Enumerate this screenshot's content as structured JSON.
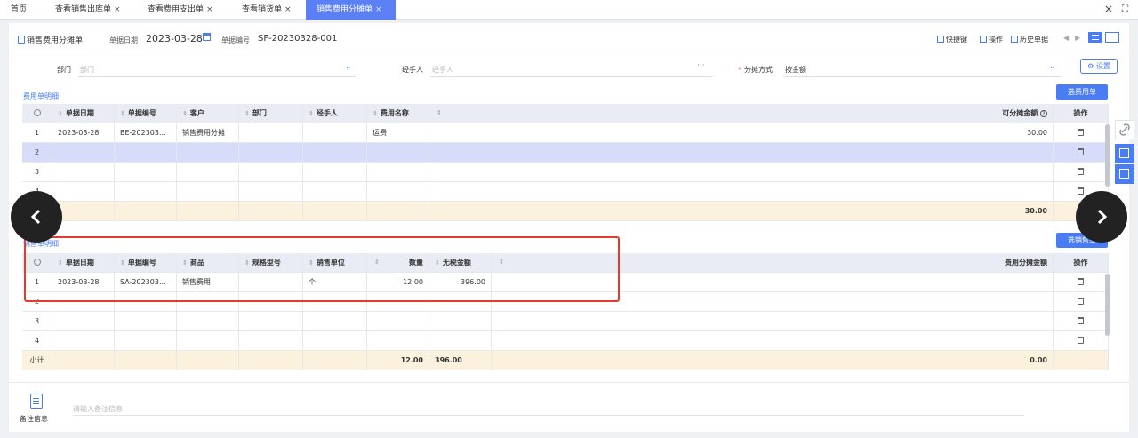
{
  "tabs": {
    "home": "首页",
    "t1": "查看销售出库单",
    "t2": "查看费用支出单",
    "t3": "查看销货单",
    "t4": "销售费用分摊单",
    "close": "×"
  },
  "header": {
    "doc_tab": "销售费用分摊单",
    "date_label": "单据日期",
    "date_value": "2023-03-28",
    "no_label": "单据编号",
    "no_value": "SF-20230328-001",
    "tools": {
      "shortcut": "快捷键",
      "operate": "操作",
      "history": "历史单据"
    }
  },
  "form": {
    "dept_label": "部门",
    "dept_placeholder": "部门",
    "handler_label": "经手人",
    "handler_placeholder": "经手人",
    "method_label": "分摊方式",
    "method_value": "按金额",
    "settings_button": "设置"
  },
  "expense": {
    "title": "费用单明细",
    "select_button": "选费用单",
    "columns": [
      "单据日期",
      "单据编号",
      "客户",
      "部门",
      "经手人",
      "费用名称",
      "可分摊金额",
      "操作"
    ],
    "rows": [
      {
        "idx": "1",
        "date": "2023-03-28",
        "no": "BE-202303...",
        "customer": "销售费用分摊",
        "dept": "",
        "handler": "",
        "name": "运费",
        "amount": "30.00"
      },
      {
        "idx": "2",
        "date": "",
        "no": "",
        "customer": "",
        "dept": "",
        "handler": "",
        "name": "",
        "amount": ""
      },
      {
        "idx": "3",
        "date": "",
        "no": "",
        "customer": "",
        "dept": "",
        "handler": "",
        "name": "",
        "amount": ""
      },
      {
        "idx": "4",
        "date": "",
        "no": "",
        "customer": "",
        "dept": "",
        "handler": "",
        "name": "",
        "amount": ""
      }
    ],
    "total_amount": "30.00"
  },
  "sales": {
    "title": "销售单明细",
    "select_button": "选销售单",
    "columns": [
      "单据日期",
      "单据编号",
      "商品",
      "规格型号",
      "销售单位",
      "数量",
      "无税金额",
      "费用分摊金额",
      "操作"
    ],
    "rows": [
      {
        "idx": "1",
        "date": "2023-03-28",
        "no": "SA-202303...",
        "product": "销售费用",
        "spec": "",
        "unit": "个",
        "qty": "12.00",
        "amount": "396.00"
      },
      {
        "idx": "2",
        "date": "",
        "no": "",
        "product": "",
        "spec": "",
        "unit": "",
        "qty": "",
        "amount": ""
      },
      {
        "idx": "3",
        "date": "",
        "no": "",
        "product": "",
        "spec": "",
        "unit": "",
        "qty": "",
        "amount": ""
      },
      {
        "idx": "4",
        "date": "",
        "no": "",
        "product": "",
        "spec": "",
        "unit": "",
        "qty": "",
        "amount": ""
      }
    ],
    "subtotal_label": "小计",
    "subtotal_qty": "12.00",
    "subtotal_amount": "396.00",
    "subtotal_alloc": "0.00"
  },
  "remark": {
    "label": "备注信息",
    "placeholder": "请输入备注信息"
  },
  "colors": {
    "accent": "#4a7cf3",
    "highlight": "#e53b2f",
    "selected_row": "#d7dcfa",
    "total_row": "#fcf1dc"
  }
}
